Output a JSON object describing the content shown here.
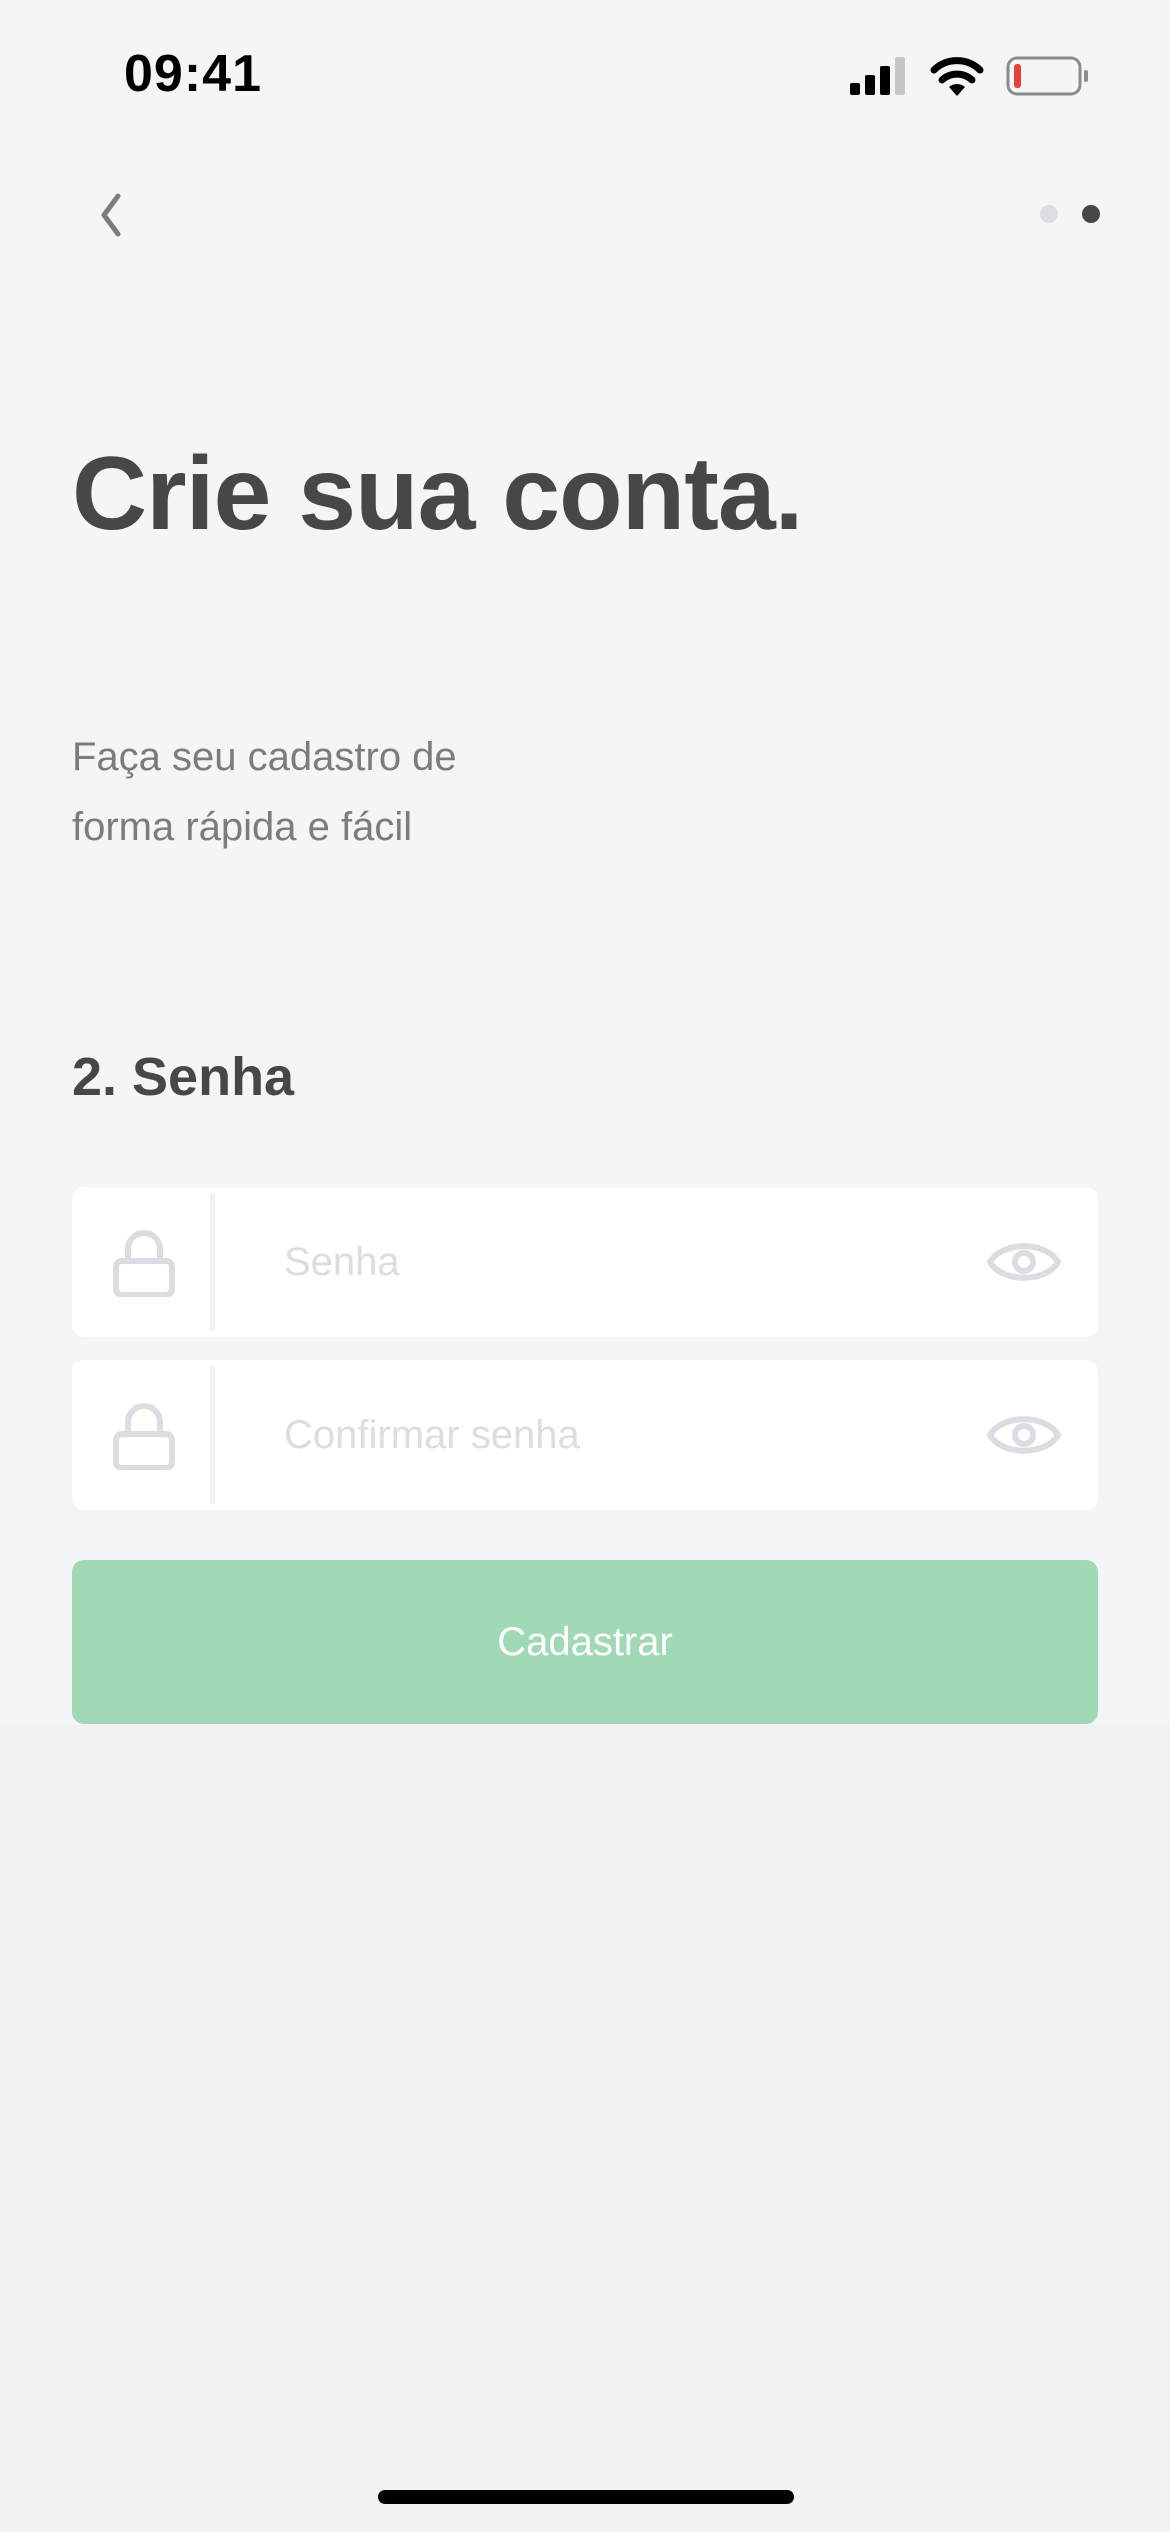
{
  "status_bar": {
    "time": "09:41",
    "icons": [
      "cellular-signal-icon",
      "wifi-icon",
      "battery-low-icon"
    ]
  },
  "nav": {
    "back_icon": "chevron-left-icon",
    "pager": {
      "total": 2,
      "current": 2
    }
  },
  "header": {
    "title": "Crie sua conta.",
    "subtitle": "Faça seu cadastro de forma rápida e fácil"
  },
  "section": {
    "title": "2. Senha"
  },
  "fields": [
    {
      "placeholder": "Senha",
      "value": "",
      "icon": "lock-icon",
      "toggle_icon": "eye-icon"
    },
    {
      "placeholder": "Confirmar senha",
      "value": "",
      "icon": "lock-icon",
      "toggle_icon": "eye-icon"
    }
  ],
  "submit": {
    "label": "Cadastrar",
    "enabled": false
  },
  "colors": {
    "background": "#f4f5f7",
    "title": "#46464b",
    "subtitle": "#7b7b80",
    "button_disabled": "#a1d9b7",
    "pager_active": "#46464b",
    "pager_inactive": "#dcdce2"
  }
}
